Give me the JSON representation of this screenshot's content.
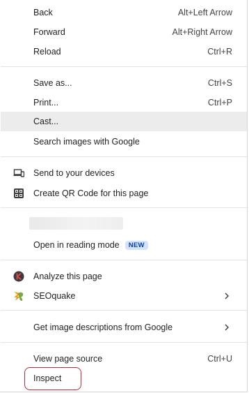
{
  "menu": {
    "back": {
      "label": "Back",
      "shortcut": "Alt+Left Arrow"
    },
    "forward": {
      "label": "Forward",
      "shortcut": "Alt+Right Arrow"
    },
    "reload": {
      "label": "Reload",
      "shortcut": "Ctrl+R"
    },
    "save_as": {
      "label": "Save as...",
      "shortcut": "Ctrl+S"
    },
    "print": {
      "label": "Print...",
      "shortcut": "Ctrl+P"
    },
    "cast": {
      "label": "Cast..."
    },
    "search_images": {
      "label": "Search images with Google"
    },
    "send_to_devices": {
      "label": "Send to your devices",
      "icon": "devices-icon"
    },
    "qr_code": {
      "label": "Create QR Code for this page",
      "icon": "qr-code-icon"
    },
    "reading_mode": {
      "label": "Open in reading mode",
      "badge": "NEW"
    },
    "analyze": {
      "label": "Analyze this page",
      "icon": "k-extension-icon"
    },
    "seoquake": {
      "label": "SEOquake",
      "icon": "seoquake-icon"
    },
    "image_descriptions": {
      "label": "Get image descriptions from Google"
    },
    "view_source": {
      "label": "View page source",
      "shortcut": "Ctrl+U"
    },
    "inspect": {
      "label": "Inspect"
    }
  },
  "colors": {
    "hover_bg": "#ececec",
    "badge_bg": "#d3e3fd",
    "badge_text": "#0842a0",
    "highlight_border": "#c0283a"
  }
}
